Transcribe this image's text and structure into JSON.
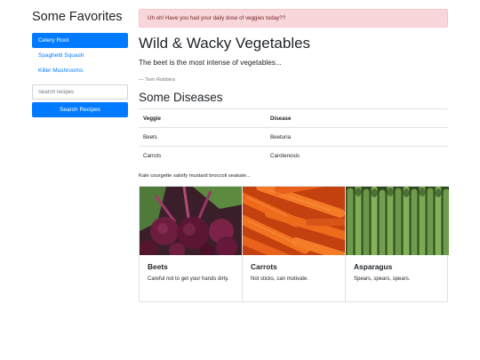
{
  "sidebar": {
    "title": "Some Favorites",
    "items": [
      {
        "label": "Celery Root",
        "active": true
      },
      {
        "label": "Spaghetti Squash",
        "active": false
      },
      {
        "label": "Killer Mushrooms",
        "active": false
      }
    ],
    "search": {
      "placeholder": "Search recipes",
      "value": ""
    },
    "search_button": "Search Recipes"
  },
  "main": {
    "alert": "Uh oh! Have you had your daily dose of veggies today??",
    "title": "Wild & Wacky Vegetables",
    "quote": "The beet is the most intense of vegetables...",
    "quote_source": "— Tom Robbins",
    "section_title": "Some Diseases",
    "table": {
      "headers": [
        "Veggie",
        "Disease"
      ],
      "rows": [
        [
          "Beets",
          "Beeturia"
        ],
        [
          "Carrots",
          "Carotenosis"
        ]
      ]
    },
    "filler": "Kale courgette salsify mustard broccoli seakale...",
    "cards": [
      {
        "title": "Beets",
        "text": "Careful not to get your hands dirty.",
        "image_icon": "beets-image"
      },
      {
        "title": "Carrots",
        "text": "Not sticks, can motivate.",
        "image_icon": "carrots-image"
      },
      {
        "title": "Asparagus",
        "text": "Spears, spears, spears.",
        "image_icon": "asparagus-image"
      }
    ]
  },
  "colors": {
    "primary": "#007bff",
    "alert_bg": "#f8d7da",
    "alert_text": "#721c24",
    "muted": "#6c757d",
    "border": "#dee2e6"
  }
}
